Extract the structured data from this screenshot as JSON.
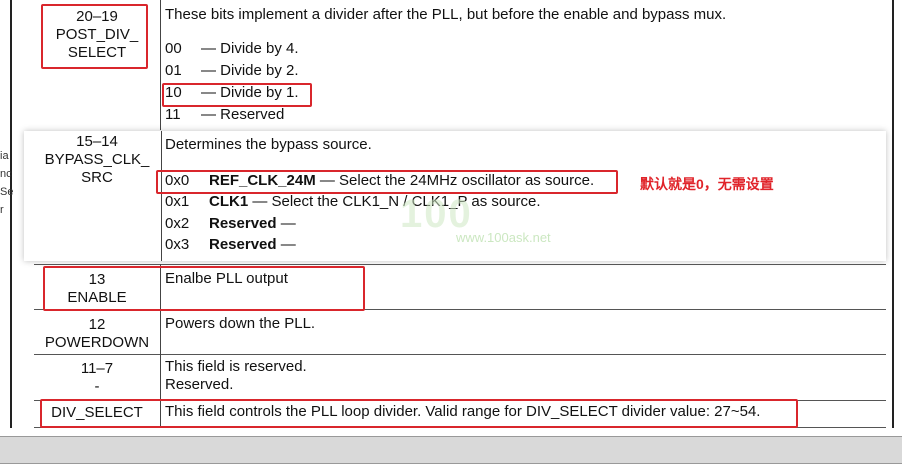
{
  "rows": {
    "post_div": {
      "field_line1": "20–19",
      "field_line2": "POST_DIV_",
      "field_line3": "SELECT",
      "description": "These bits implement a divider after the PLL, but before the enable and bypass mux.",
      "options": [
        {
          "code": "00",
          "text": "— Divide by 4."
        },
        {
          "code": "01",
          "text": "— Divide by 2."
        },
        {
          "code": "10",
          "text": "— Divide by 1."
        },
        {
          "code": "11",
          "text": "— Reserved"
        }
      ]
    },
    "bypass": {
      "field_line1": "15–14",
      "field_line2": "BYPASS_CLK_",
      "field_line3": "SRC",
      "description": "Determines the bypass source.",
      "options": [
        {
          "code": "0x0",
          "name": "REF_CLK_24M",
          "text": " — Select the 24MHz oscillator as source."
        },
        {
          "code": "0x1",
          "name": "CLK1",
          "text": " — Select the CLK1_N / CLK1_P as source."
        },
        {
          "code": "0x2",
          "name": "Reserved",
          "text": " —"
        },
        {
          "code": "0x3",
          "name": "Reserved",
          "text": " —"
        }
      ],
      "note": "默认就是0，无需设置"
    },
    "enable": {
      "field_line1": "13",
      "field_line2": "ENABLE",
      "description": "Enalbe PLL output"
    },
    "powerdown": {
      "field_line1": "12",
      "field_line2": "POWERDOWN",
      "description": "Powers down the PLL."
    },
    "reserved": {
      "field_line1": "11–7",
      "field_line2": "-",
      "desc_line1": "This field is reserved.",
      "desc_line2": "Reserved."
    },
    "div_select": {
      "field": "DIV_SELECT",
      "description": "This field controls the PLL loop divider. Valid range for DIV_SELECT divider value: 27~54."
    }
  },
  "watermark": {
    "logo": "100",
    "url": "www.100ask.net"
  },
  "side_fragments": [
    "ia",
    "nc",
    "Se",
    "r"
  ],
  "colors": {
    "highlight": "#d9262c",
    "note": "#e0242a",
    "bar": "#d9d9d9"
  }
}
